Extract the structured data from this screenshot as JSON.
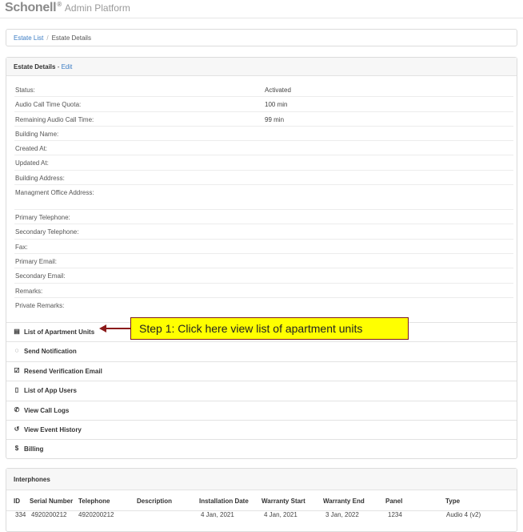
{
  "app": {
    "brand": "Schonell",
    "platform": "Admin Platform"
  },
  "breadcrumb": {
    "root": "Estate List",
    "separator": "/",
    "current": "Estate Details"
  },
  "details": {
    "title": "Estate Details",
    "dash": " - ",
    "edit_label": "Edit",
    "rows": [
      {
        "label": "Status:",
        "value": "Activated"
      },
      {
        "label": "Audio Call Time Quota:",
        "value": "100 min"
      },
      {
        "label": "Remaining Audio Call Time:",
        "value": "99 min"
      },
      {
        "label": "Building Name:",
        "value": ""
      },
      {
        "label": "Created At:",
        "value": ""
      },
      {
        "label": "Updated At:",
        "value": ""
      },
      {
        "label": "Building Address:",
        "value": ""
      },
      {
        "label": "Managment Office Address:",
        "value": ""
      },
      {
        "label": "Primary Telephone:",
        "value": ""
      },
      {
        "label": "Secondary Telephone:",
        "value": ""
      },
      {
        "label": "Fax:",
        "value": ""
      },
      {
        "label": "Primary Email:",
        "value": ""
      },
      {
        "label": "Secondary Email:",
        "value": ""
      },
      {
        "label": "Remarks:",
        "value": ""
      },
      {
        "label": "Private Remarks:",
        "value": ""
      }
    ]
  },
  "actions": [
    {
      "label": "List of Apartment Units",
      "icon": "id-card-icon",
      "glyph": "▤"
    },
    {
      "label": "Send Notification",
      "icon": "comment-icon",
      "glyph": "◌"
    },
    {
      "label": "Resend Verification Email",
      "icon": "check-square-icon",
      "glyph": "☑"
    },
    {
      "label": "List of App Users",
      "icon": "mobile-icon",
      "glyph": "▯"
    },
    {
      "label": "View Call Logs",
      "icon": "phone-icon",
      "glyph": "✆"
    },
    {
      "label": "View Event History",
      "icon": "history-icon",
      "glyph": "↺"
    },
    {
      "label": "Billing",
      "icon": "dollar-icon",
      "glyph": "$"
    }
  ],
  "callout": {
    "text": "Step 1: Click here view list of apartment units"
  },
  "interphones": {
    "title": "Interphones",
    "columns": [
      "ID",
      "Serial Number",
      "Telephone",
      "Description",
      "Installation Date",
      "Warranty Start",
      "Warranty End",
      "Panel",
      "Type"
    ],
    "rows": [
      [
        "334",
        "4920200212",
        "4920200212",
        "",
        "4 Jan, 2021",
        "4 Jan, 2021",
        "3 Jan, 2022",
        "1234",
        "Audio 4 (v2)"
      ]
    ]
  },
  "colors": {
    "link": "#3a7cc4",
    "callout_bg": "#ffff00",
    "arrow": "#8b1a1a"
  }
}
